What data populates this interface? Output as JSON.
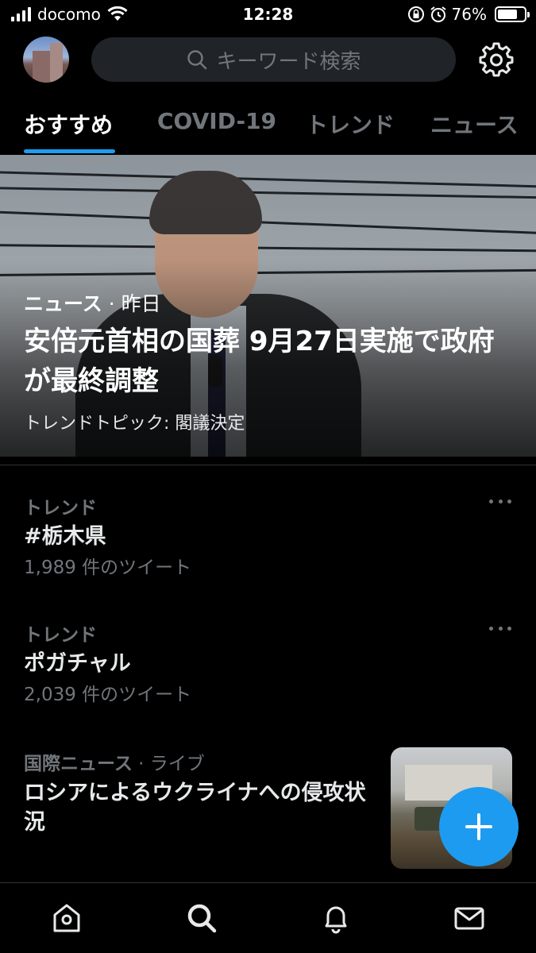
{
  "status_bar": {
    "carrier": "docomo",
    "time": "12:28",
    "battery": "76%",
    "battery_level": 0.76
  },
  "header": {
    "search_placeholder": "キーワード検索",
    "icons": [
      "search-icon",
      "gear-icon"
    ]
  },
  "tabs": [
    {
      "label": "おすすめ",
      "active": true
    },
    {
      "label": "COVID-19",
      "active": false
    },
    {
      "label": "トレンド",
      "active": false
    },
    {
      "label": "ニュース",
      "active": false
    }
  ],
  "hero": {
    "category": "ニュース",
    "time": "· 昨日",
    "title": "安倍元首相の国葬 9月27日実施で政府が最終調整",
    "subtitle": "トレンドトピック: 閣議決定"
  },
  "trends": [
    {
      "category": "トレンド",
      "name": "#栃木県",
      "count": "1,989 件のツイート"
    },
    {
      "category": "トレンド",
      "name": "ポガチャル",
      "count": "2,039 件のツイート"
    }
  ],
  "news": {
    "category": "国際ニュース",
    "live": "· ライブ",
    "title": "ロシアによるウクライナへの侵攻状況"
  },
  "bottom_nav": [
    "home-icon",
    "search-icon",
    "notifications-icon",
    "messages-icon"
  ],
  "colors": {
    "accent": "#1d9bf0",
    "background": "#000000",
    "secondary_text": "#71767b"
  }
}
